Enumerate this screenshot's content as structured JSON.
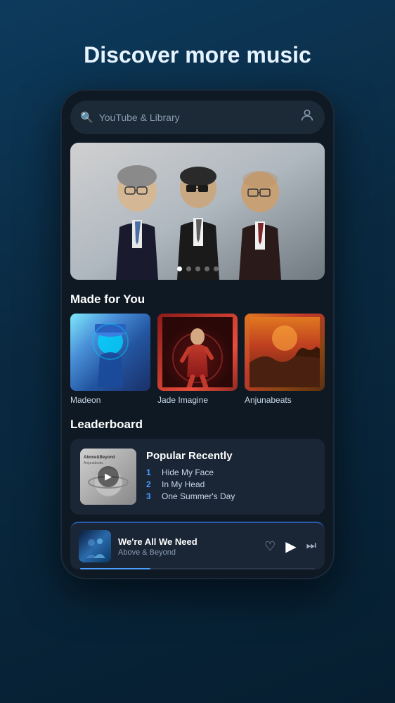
{
  "hero": {
    "title": "Discover more music"
  },
  "search": {
    "placeholder": "YouTube & Library",
    "icon": "search",
    "profile_icon": "person"
  },
  "banner": {
    "dots": [
      true,
      false,
      false,
      false,
      false
    ]
  },
  "made_for_you": {
    "section_title": "Made for You",
    "cards": [
      {
        "label": "Madeon",
        "thumb_type": "madeon"
      },
      {
        "label": "Jade Imagine",
        "thumb_type": "jade"
      },
      {
        "label": "Anjunabeats",
        "thumb_type": "anjuna"
      }
    ]
  },
  "leaderboard": {
    "section_title": "Leaderboard",
    "card_title": "Popular Recently",
    "tracks": [
      {
        "num": "1",
        "name": "Hide My Face",
        "num_class": "n1"
      },
      {
        "num": "2",
        "name": "In My Head",
        "num_class": "n2"
      },
      {
        "num": "3",
        "name": "One Summer's Day",
        "num_class": "n3"
      }
    ]
  },
  "now_playing": {
    "title": "We're All We Need",
    "artist": "Above & Beyond",
    "progress_pct": 30
  }
}
